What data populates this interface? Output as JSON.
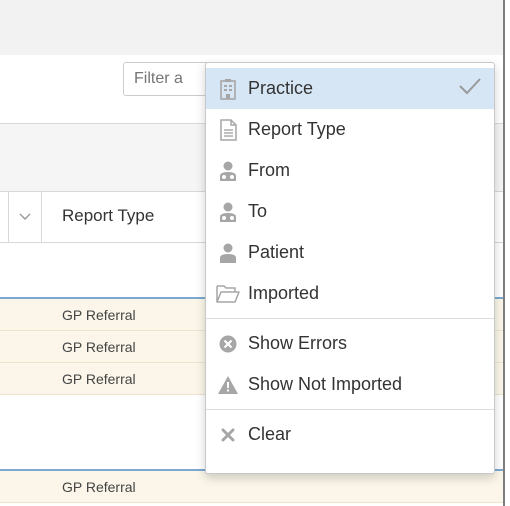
{
  "filter": {
    "placeholder": "Filter a"
  },
  "table": {
    "column_header": "Report Type",
    "group1_rows": [
      "GP Referral",
      "GP Referral",
      "GP Referral"
    ],
    "group2_rows": [
      "GP Referral"
    ]
  },
  "menu": {
    "items": [
      {
        "label": "Practice",
        "icon": "building-icon",
        "selected": true
      },
      {
        "label": "Report Type",
        "icon": "document-icon"
      },
      {
        "label": "From",
        "icon": "user-group-icon"
      },
      {
        "label": "To",
        "icon": "user-group-icon"
      },
      {
        "label": "Patient",
        "icon": "user-icon"
      },
      {
        "label": "Imported",
        "icon": "folder-open-icon"
      }
    ],
    "error_items": [
      {
        "label": "Show Errors",
        "icon": "error-circle-icon"
      },
      {
        "label": "Show Not Imported",
        "icon": "warning-icon"
      }
    ],
    "clear": {
      "label": "Clear",
      "icon": "clear-x-icon"
    }
  },
  "colors": {
    "selected_bg": "#d6e6f5",
    "row_bg": "#fbf6e9",
    "group_accent": "#7aa8d0",
    "icon_gray": "#a6a6a6"
  }
}
